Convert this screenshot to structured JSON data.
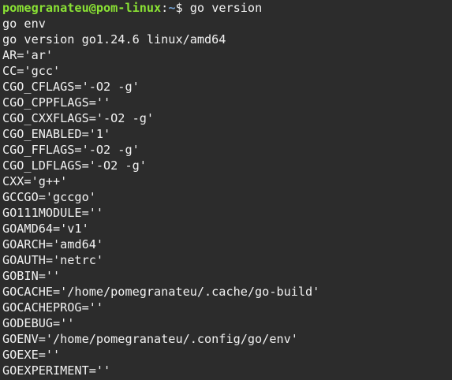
{
  "colors": {
    "background": "#2c2c2c",
    "foreground": "#f2f2f2",
    "prompt_user": "#8ae234",
    "prompt_path": "#729fcf"
  },
  "prompt": {
    "user_host": "pomegranateu@pom-linux",
    "colon": ":",
    "path": "~",
    "symbol": "$ ",
    "command": "go version"
  },
  "lines": [
    "go env",
    "go version go1.24.6 linux/amd64",
    "AR='ar'",
    "CC='gcc'",
    "CGO_CFLAGS='-O2 -g'",
    "CGO_CPPFLAGS=''",
    "CGO_CXXFLAGS='-O2 -g'",
    "CGO_ENABLED='1'",
    "CGO_FFLAGS='-O2 -g'",
    "CGO_LDFLAGS='-O2 -g'",
    "CXX='g++'",
    "GCCGO='gccgo'",
    "GO111MODULE=''",
    "GOAMD64='v1'",
    "GOARCH='amd64'",
    "GOAUTH='netrc'",
    "GOBIN=''",
    "GOCACHE='/home/pomegranateu/.cache/go-build'",
    "GOCACHEPROG=''",
    "GODEBUG=''",
    "GOENV='/home/pomegranateu/.config/go/env'",
    "GOEXE=''",
    "GOEXPERIMENT=''"
  ]
}
